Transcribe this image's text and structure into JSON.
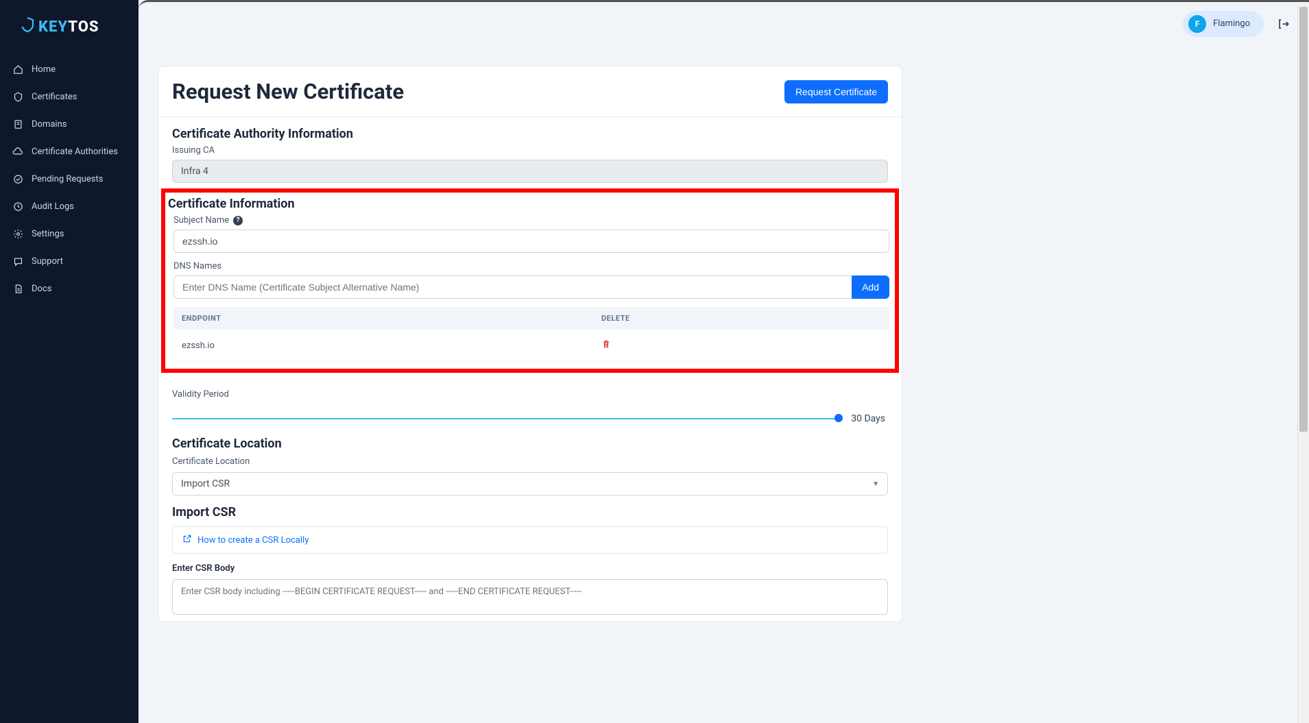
{
  "brand": {
    "key": "KEY",
    "tos": "TOS"
  },
  "sidebar": {
    "items": [
      {
        "label": "Home"
      },
      {
        "label": "Certificates"
      },
      {
        "label": "Domains"
      },
      {
        "label": "Certificate Authorities"
      },
      {
        "label": "Pending Requests"
      },
      {
        "label": "Audit Logs"
      },
      {
        "label": "Settings"
      },
      {
        "label": "Support"
      },
      {
        "label": "Docs"
      }
    ]
  },
  "header": {
    "user_initial": "F",
    "user_name": "Flamingo"
  },
  "page": {
    "title": "Request New Certificate",
    "request_button": "Request Certificate",
    "ca_section_title": "Certificate Authority Information",
    "issuing_ca_label": "Issuing CA",
    "issuing_ca_value": "Infra 4",
    "cert_info_title": "Certificate Information",
    "subject_name_label": "Subject Name",
    "subject_name_value": "ezssh.io",
    "dns_names_label": "DNS Names",
    "dns_placeholder": "Enter DNS Name (Certificate Subject Alternative Name)",
    "add_button": "Add",
    "table_headers": {
      "endpoint": "ENDPOINT",
      "delete": "DELETE"
    },
    "endpoints": [
      {
        "name": "ezssh.io"
      }
    ],
    "validity_label": "Validity Period",
    "validity_value": "30 Days",
    "location_title": "Certificate Location",
    "location_label": "Certificate Location",
    "location_value": "Import CSR",
    "import_csr_title": "Import CSR",
    "csr_help_link": "How to create a CSR Locally",
    "csr_body_label": "Enter CSR Body",
    "csr_body_placeholder": "Enter CSR body including -----BEGIN CERTIFICATE REQUEST----- and -----END CERTIFICATE REQUEST-----"
  }
}
